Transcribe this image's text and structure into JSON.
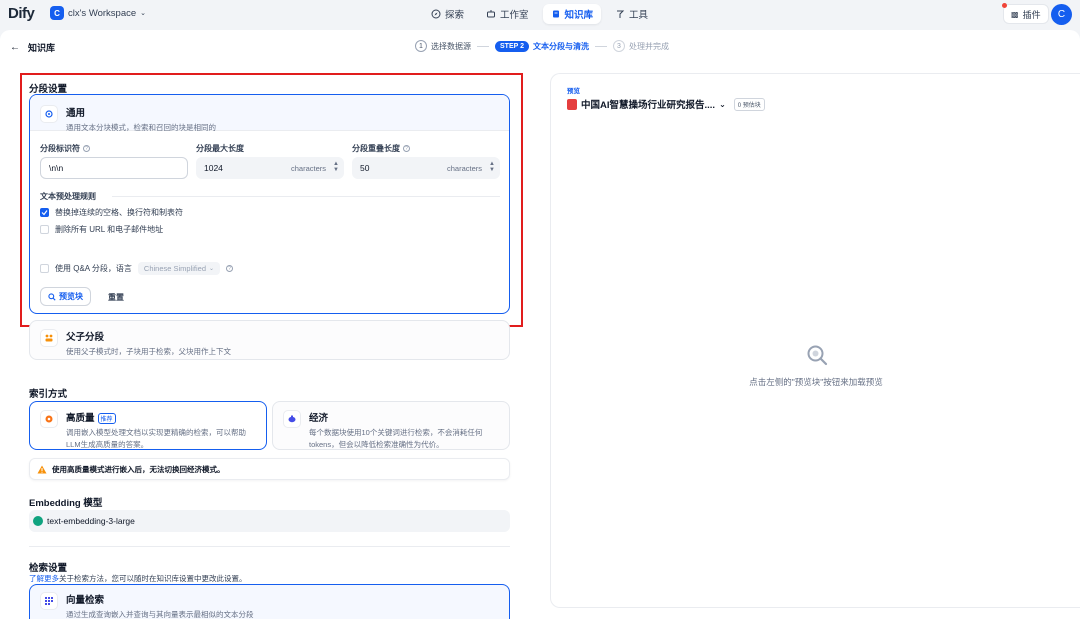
{
  "app": {
    "logo": "Dify"
  },
  "workspace": {
    "initial": "C",
    "name": "clx's Workspace"
  },
  "nav": {
    "explore": "探索",
    "studio": "工作室",
    "knowledge": "知识库",
    "tools": "工具"
  },
  "header_right": {
    "plugins": "插件",
    "user_initial": "C"
  },
  "breadcrumb": {
    "back_label": "知识库"
  },
  "steps": [
    {
      "num": "1",
      "label": "选择数据源"
    },
    {
      "pill": "STEP 2",
      "label": "文本分段与清洗"
    },
    {
      "num": "3",
      "label": "处理并完成"
    }
  ],
  "segment": {
    "section_title": "分段设置",
    "general": {
      "title": "通用",
      "desc": "通用文本分块模式，检索和召回的块是相同的",
      "delimiter_label": "分段标识符",
      "delimiter_value": "\\n\\n",
      "max_len_label": "分段最大长度",
      "max_len_value": "1024",
      "max_len_unit": "characters",
      "overlap_label": "分段重叠长度",
      "overlap_value": "50",
      "overlap_unit": "characters",
      "rules_label": "文本预处理规则",
      "rule_1": "替换掉连续的空格、换行符和制表符",
      "rule_2": "删除所有 URL 和电子邮件地址",
      "qa_label": "使用 Q&A 分段，语言",
      "qa_lang": "Chinese Simplified",
      "preview_btn": "预览块",
      "reset_btn": "重置"
    },
    "parent_child": {
      "title": "父子分段",
      "desc": "使用父子模式时，子块用于检索，父块用作上下文"
    }
  },
  "index": {
    "section_title": "索引方式",
    "high": {
      "title": "高质量",
      "badge": "推荐",
      "desc_1": "调用嵌入模型处理文档以实现更精确的检索，可以帮助",
      "desc_2": "LLM生成高质量的答案。"
    },
    "economy": {
      "title": "经济",
      "desc_1": "每个数据块使用10个关键词进行检索，不会消耗任何",
      "desc_2": "tokens，但会以降低检索准确性为代价。"
    },
    "warning": "使用高质量模式进行嵌入后，无法切换回经济模式。"
  },
  "embedding": {
    "section_title": "Embedding 模型",
    "model": "text-embedding-3-large"
  },
  "retrieval": {
    "section_title": "检索设置",
    "link": "了解更多",
    "sub": "关于检索方法，您可以随时在知识库设置中更改此设置。",
    "vector_title": "向量检索",
    "vector_desc": "通过生成查询嵌入并查询与其向量表示最相似的文本分段"
  },
  "preview": {
    "label": "预览",
    "doc_name": "中国AI智慧操场行业研究报告....",
    "count": "0 预估块",
    "empty": "点击左侧的\"预览块\"按钮来加载预览"
  },
  "colors": {
    "accent": "#155eef",
    "highlight_box": "#e11d1d",
    "warning": "#f79009"
  }
}
